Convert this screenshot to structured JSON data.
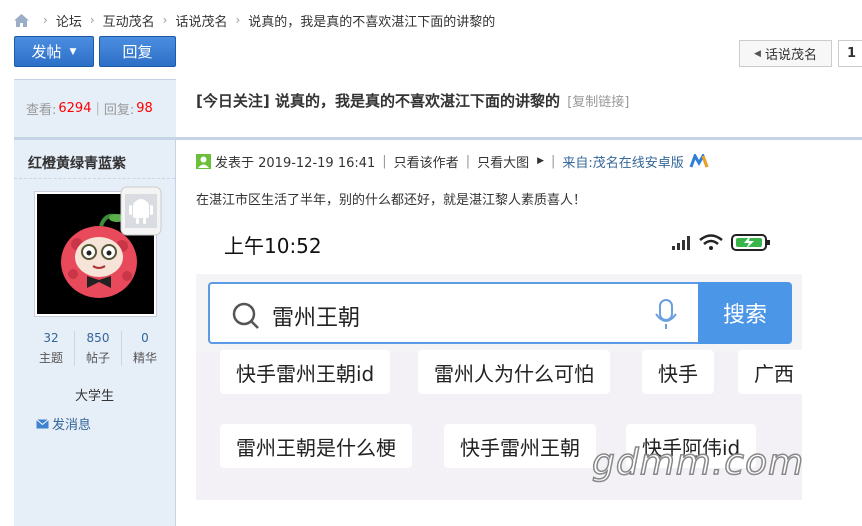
{
  "breadcrumb": {
    "items": [
      "论坛",
      "互动茂名",
      "话说茂名",
      "说真的，我是真的不喜欢湛江下面的讲黎的"
    ]
  },
  "toolbar": {
    "post_label": "发帖",
    "reply_label": "回复",
    "back_label": "话说茂名",
    "page_number": "1"
  },
  "thread_stats": {
    "views_label": "查看:",
    "views": "6294",
    "replies_label": "回复:",
    "replies": "98"
  },
  "thread": {
    "tag": "[今日关注]",
    "title": "说真的，我是真的不喜欢湛江下面的讲黎的",
    "copy_link": "[复制链接]"
  },
  "author": {
    "name": "红橙黄绿青蓝紫",
    "stats": [
      {
        "num": "32",
        "label": "主题"
      },
      {
        "num": "850",
        "label": "帖子"
      },
      {
        "num": "0",
        "label": "精华"
      }
    ],
    "rank": "大学生",
    "pm_label": "发消息"
  },
  "post": {
    "posted_at": "发表于 2019-12-19 16:41",
    "only_author": "只看该作者",
    "large_images": "只看大图",
    "source": "来自:茂名在线安卓版",
    "content": "在湛江市区生活了半年，别的什么都还好，就是湛江黎人素质喜人！"
  },
  "screenshot": {
    "time": "上午10:52",
    "search_query": "雷州王朝",
    "search_button": "搜索",
    "suggestions": [
      "快手雷州王朝id",
      "雷州人为什么可怕",
      "快手",
      "广西",
      "雷州王朝是什么梗",
      "快手雷州王朝",
      "快手阿伟id"
    ],
    "watermark": "gdmm.com"
  },
  "colors": {
    "accent": "#2c6fc7",
    "link": "#336699",
    "highlight": "#ff0000",
    "sidebar": "#e6eef8"
  }
}
